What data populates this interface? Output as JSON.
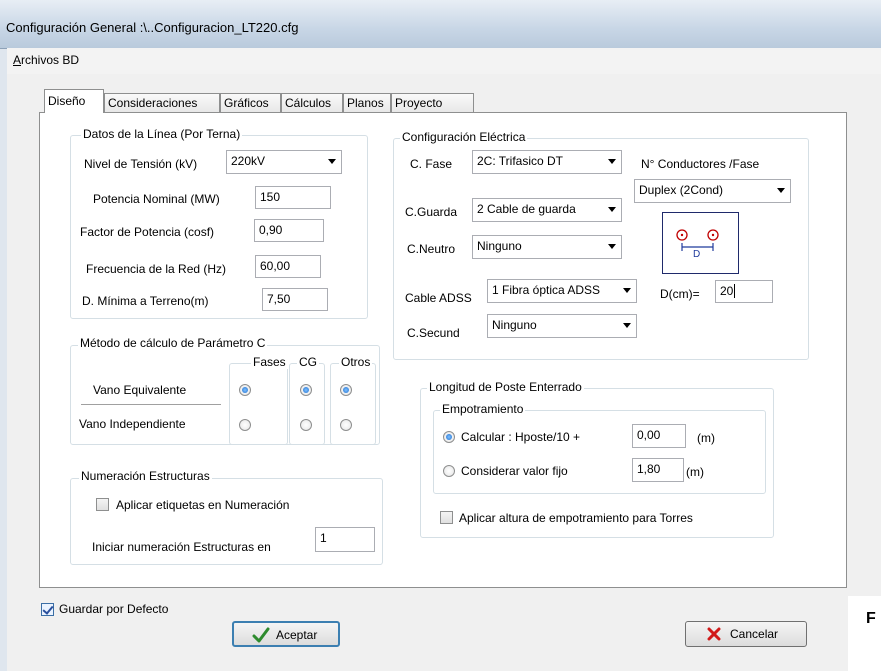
{
  "window": {
    "title": "Configuración General :\\..Configuracion_LT220.cfg"
  },
  "menu": {
    "archivos": "Archivos BD"
  },
  "tabs": [
    {
      "label": "Diseño",
      "active": true
    },
    {
      "label": "Consideraciones"
    },
    {
      "label": "Gráficos"
    },
    {
      "label": "Cálculos"
    },
    {
      "label": "Planos"
    },
    {
      "label": "Proyecto"
    }
  ],
  "datos": {
    "title": "Datos de la Línea (Por Terna)",
    "nivel_label": "Nivel de Tensión (kV)",
    "nivel_value": "220kV",
    "potencia_label": "Potencia Nominal (MW)",
    "potencia_value": "150",
    "factor_label": "Factor de Potencia (cosf)",
    "factor_value": "0,90",
    "frecuencia_label": "Frecuencia de la Red (Hz)",
    "frecuencia_value": "60,00",
    "dmin_label": "D. Mínima a Terreno(m)",
    "dmin_value": "7,50"
  },
  "metodo": {
    "title": "Método de cálculo de Parámetro C",
    "col_fases": "Fases",
    "col_cg": "CG",
    "col_otros": "Otros",
    "row_equivalente": "Vano Equivalente",
    "row_independiente": "Vano Independiente",
    "selected_row": "Vano Equivalente"
  },
  "numeracion": {
    "title": "Numeración Estructuras",
    "aplicar_label": "Aplicar etiquetas en Numeración",
    "aplicar_checked": false,
    "iniciar_label": "Iniciar numeración Estructuras en",
    "iniciar_value": "1"
  },
  "electrica": {
    "title": "Configuración Eléctrica",
    "fase_label": "C. Fase",
    "fase_value": "2C: Trifasico DT",
    "conductores_label": "N° Conductores /Fase",
    "conductores_value": "Duplex (2Cond)",
    "guarda_label": "C.Guarda",
    "guarda_value": "2 Cable de guarda",
    "neutro_label": "C.Neutro",
    "neutro_value": "Ninguno",
    "adss_label": "Cable ADSS",
    "adss_value": "1 Fibra óptica ADSS",
    "dcm_label": "D(cm)=",
    "dcm_value": "20",
    "secund_label": "C.Secund",
    "secund_value": "Ninguno",
    "diagram_label": "D"
  },
  "poste": {
    "title": "Longitud de Poste Enterrado",
    "empotramiento_title": "Empotramiento",
    "calcular_label": "Calcular :  Hposte/10 +",
    "calcular_value": "0,00",
    "calcular_unit": "(m)",
    "fijo_label": "Considerar valor  fijo",
    "fijo_value": "1,80",
    "fijo_unit": "(m)",
    "selected": "Calcular",
    "altura_label": "Aplicar altura de empotramiento para Torres",
    "altura_checked": false
  },
  "footer": {
    "guardar_label": "Guardar por Defecto",
    "guardar_checked": true,
    "aceptar_label": "Aceptar",
    "cancelar_label": "Cancelar",
    "side_text": "F"
  }
}
